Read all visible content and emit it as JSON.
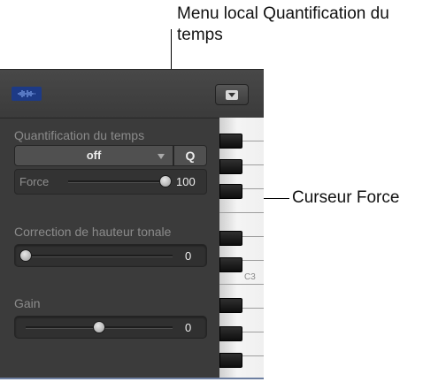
{
  "callouts": {
    "quantize_menu": "Menu local Quantification du temps",
    "force_slider": "Curseur Force"
  },
  "panel": {
    "region_icon": "waveform-icon",
    "menu_icon": "popup-menu-icon"
  },
  "quantize": {
    "label": "Quantification du temps",
    "value": "off",
    "q_button": "Q"
  },
  "force": {
    "label": "Force",
    "value": "100",
    "level": 1.0
  },
  "pitch_correction": {
    "label": "Correction de hauteur tonale",
    "value": "0",
    "level": 0.0
  },
  "gain": {
    "label": "Gain",
    "value": "0",
    "level": 0.5
  },
  "keyboard": {
    "note_label": "C3"
  },
  "colors": {
    "panel_bg": "#3b3b3b",
    "region_icon": "#1d3a86",
    "callout_line": "#000000"
  }
}
